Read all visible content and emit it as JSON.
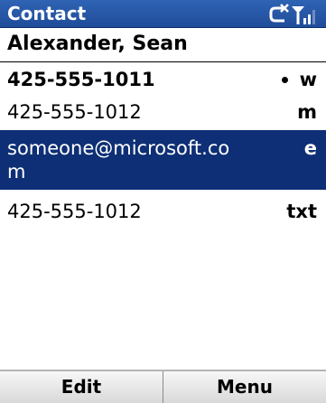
{
  "titlebar": {
    "title": "Contact",
    "icons": [
      "no-sync-icon",
      "signal-strength-icon"
    ]
  },
  "contact": {
    "name": "Alexander, Sean"
  },
  "fields": [
    {
      "value": "425-555-1011",
      "tag": "w",
      "default": true,
      "selected": false
    },
    {
      "value": "425-555-1012",
      "tag": "m",
      "default": false,
      "selected": false
    },
    {
      "value": "someone@microsoft.com",
      "tag": "e",
      "default": false,
      "selected": true
    },
    {
      "value": "425-555-1012",
      "tag": "txt",
      "default": false,
      "selected": false
    }
  ],
  "softkeys": {
    "left": "Edit",
    "right": "Menu"
  },
  "colors": {
    "titlebar": "#1f4c99",
    "selection": "#0e2f75"
  }
}
